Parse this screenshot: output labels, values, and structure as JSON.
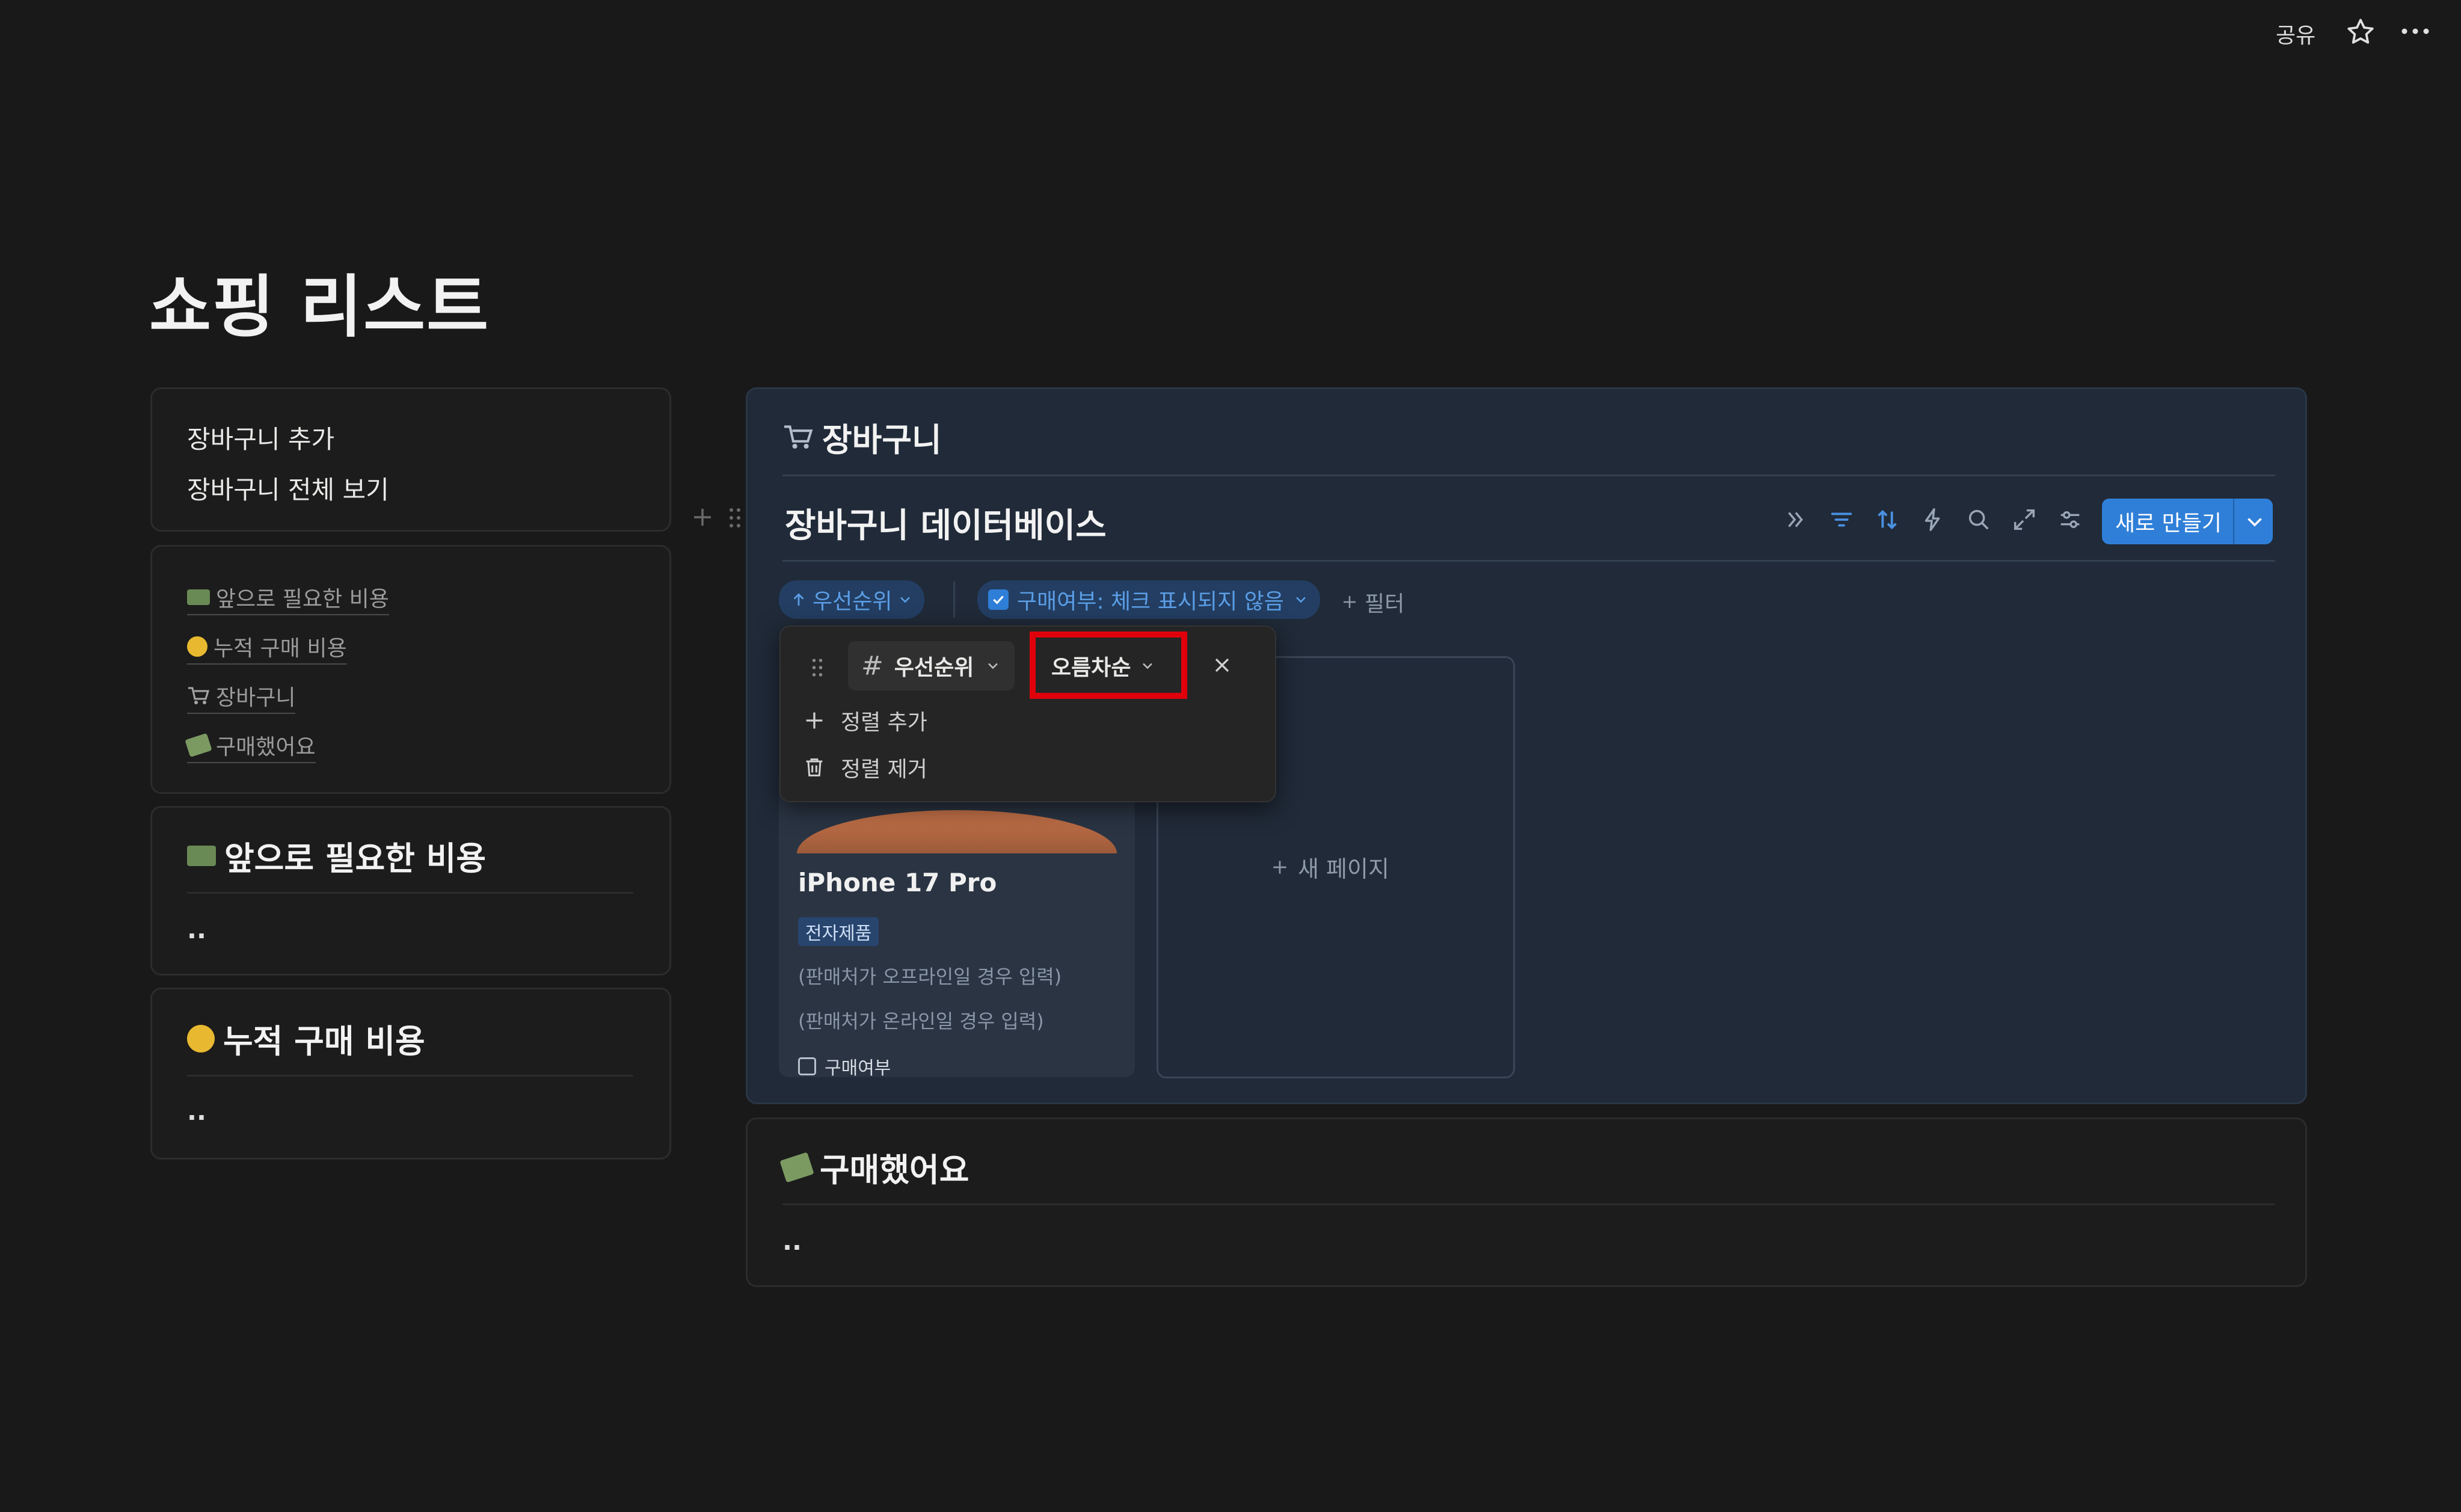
{
  "topbar": {
    "share_label": "공유",
    "star_icon": "star-icon",
    "more_icon": "more-icon"
  },
  "page": {
    "title": "쇼핑 리스트"
  },
  "left": {
    "quick_links": [
      "장바구니 추가",
      "장바구니 전체 보기"
    ],
    "toc": [
      {
        "emoji": "money-emoji",
        "label": "앞으로 필요한 비용"
      },
      {
        "emoji": "money-face-emoji",
        "label": "누적 구매 비용"
      },
      {
        "emoji": "cart-emoji",
        "label": "장바구니"
      },
      {
        "emoji": "flying-money-emoji",
        "label": "구매했어요"
      }
    ],
    "future_cost": {
      "title": "앞으로 필요한 비용",
      "value": ".."
    },
    "accumulated_cost": {
      "title": "누적 구매 비용",
      "value": ".."
    }
  },
  "cart": {
    "heading": "장바구니",
    "db_title": "장바구니 데이터베이스",
    "new_button_label": "새로 만들기",
    "sort_chip": "우선순위",
    "filter_chip": "구매여부: 체크 표시되지 않음",
    "add_filter": "필터",
    "card": {
      "title": "iPhone 17 Pro",
      "tag": "전자제품",
      "offline_hint": "(판매처가 오프라인일 경우 입력)",
      "online_hint": "(판매처가 온라인일 경우 입력)",
      "checkbox_label": "구매여부"
    },
    "new_page_label": "새 페이지"
  },
  "sort_popup": {
    "property": "우선순위",
    "direction": "오름차순",
    "add_sort": "정렬 추가",
    "remove_sort": "정렬 제거"
  },
  "purchased": {
    "title": "구매했어요",
    "value": ".."
  },
  "colors": {
    "accent": "#2f7fd8",
    "highlight": "#e0000b",
    "panel": "#202a38"
  }
}
